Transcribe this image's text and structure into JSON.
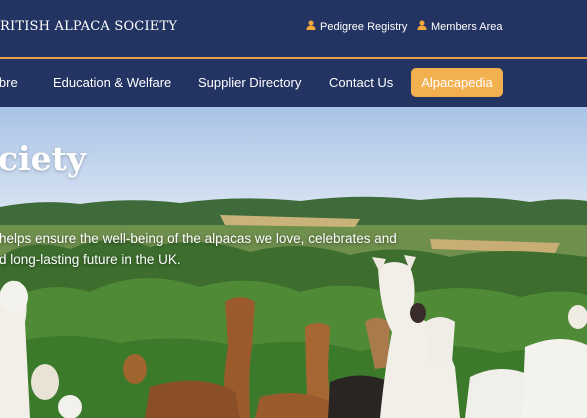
{
  "header": {
    "brand": "RITISH ALPACA SOCIETY",
    "utility_links": [
      {
        "label": "Pedigree Registry",
        "icon": "user-icon"
      },
      {
        "label": "Members Area",
        "icon": "user-icon"
      }
    ]
  },
  "nav": {
    "items": [
      {
        "label": "ibre"
      },
      {
        "label": "Education & Welfare"
      },
      {
        "label": "Supplier Directory"
      },
      {
        "label": "Contact Us"
      }
    ],
    "cta_label": "Alpacapedia"
  },
  "hero": {
    "title": "ciety",
    "line1": "helps ensure the well-being of the alpacas we love, celebrates and",
    "line2": "d long-lasting future in the UK."
  },
  "colors": {
    "navy": "#233463",
    "accent": "#e8a24c",
    "cta": "#f2b04f"
  }
}
